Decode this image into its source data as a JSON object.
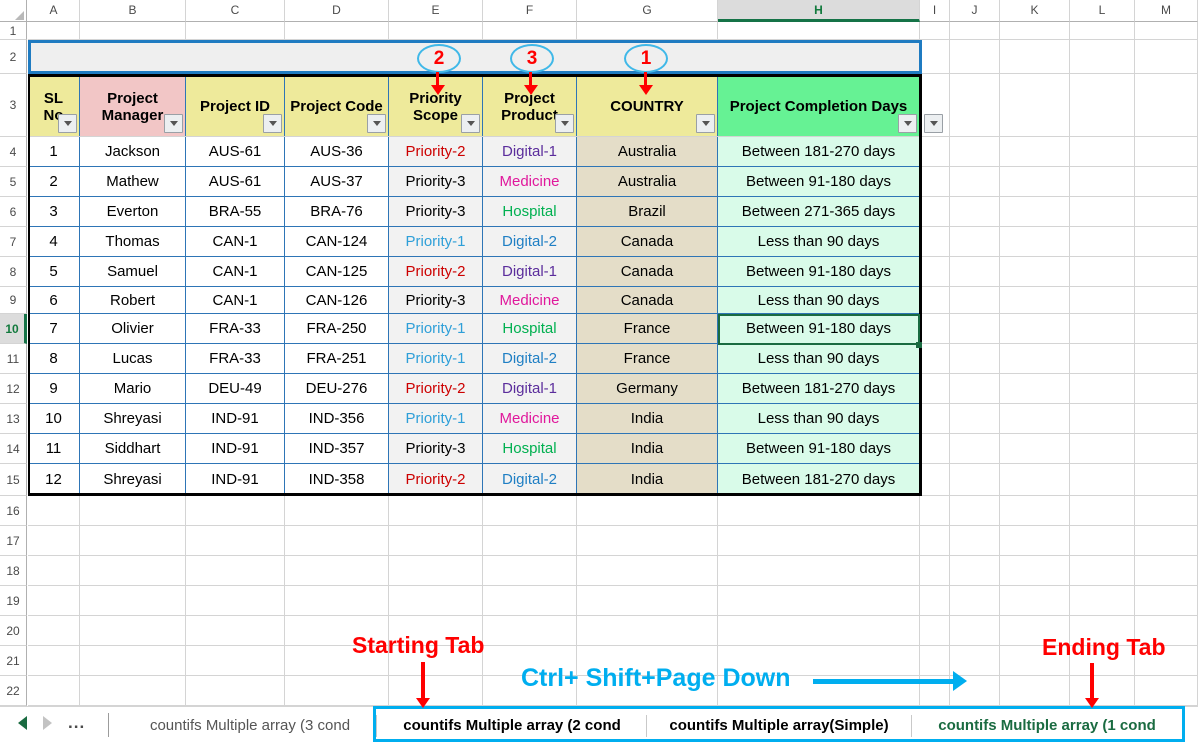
{
  "app": {
    "type": "spreadsheet"
  },
  "grid": {
    "column_letters": [
      "A",
      "B",
      "C",
      "D",
      "E",
      "F",
      "G",
      "H",
      "I",
      "J",
      "K",
      "L",
      "M"
    ],
    "selected_column": "H",
    "row_numbers": [
      "1",
      "2",
      "3",
      "4",
      "5",
      "6",
      "7",
      "8",
      "9",
      "10",
      "11",
      "12",
      "13",
      "14",
      "15",
      "16",
      "17",
      "18",
      "19",
      "20",
      "21",
      "22"
    ],
    "selected_row": "10",
    "active_cell": "H10"
  },
  "table": {
    "headers": [
      {
        "label": "SL No",
        "bg": "#eeea9b"
      },
      {
        "label": "Project Manager",
        "bg": "#f2c6c6"
      },
      {
        "label": "Project ID",
        "bg": "#eeea9b"
      },
      {
        "label": "Project Code",
        "bg": "#eeea9b"
      },
      {
        "label": "Priority Scope",
        "bg": "#eeea9b"
      },
      {
        "label": "Project Product",
        "bg": "#eeea9b"
      },
      {
        "label": "COUNTRY",
        "bg": "#eeea9b"
      },
      {
        "label": "Project Completion Days",
        "bg": "#66f294"
      }
    ],
    "rows": [
      {
        "sl": "1",
        "manager": "Jackson",
        "project_id": "AUS-61",
        "project_code": "AUS-36",
        "priority": "Priority-2",
        "priority_color": "#cc0000",
        "product": "Digital-1",
        "product_color": "#5b2d9c",
        "country": "Australia",
        "days": "Between 181-270 days"
      },
      {
        "sl": "2",
        "manager": "Mathew",
        "project_id": "AUS-61",
        "project_code": "AUS-37",
        "priority": "Priority-3",
        "priority_color": "#000000",
        "product": "Medicine",
        "product_color": "#e0189c",
        "country": "Australia",
        "days": "Between 91-180 days"
      },
      {
        "sl": "3",
        "manager": "Everton",
        "project_id": "BRA-55",
        "project_code": "BRA-76",
        "priority": "Priority-3",
        "priority_color": "#000000",
        "product": "Hospital",
        "product_color": "#00b050",
        "country": "Brazil",
        "days": "Between 271-365 days"
      },
      {
        "sl": "4",
        "manager": "Thomas",
        "project_id": "CAN-1",
        "project_code": "CAN-124",
        "priority": "Priority-1",
        "priority_color": "#2e9fd8",
        "product": "Digital-2",
        "product_color": "#1f7fc4",
        "country": "Canada",
        "days": "Less than 90 days"
      },
      {
        "sl": "5",
        "manager": "Samuel",
        "project_id": "CAN-1",
        "project_code": "CAN-125",
        "priority": "Priority-2",
        "priority_color": "#cc0000",
        "product": "Digital-1",
        "product_color": "#5b2d9c",
        "country": "Canada",
        "days": "Between 91-180 days"
      },
      {
        "sl": "6",
        "manager": "Robert",
        "project_id": "CAN-1",
        "project_code": "CAN-126",
        "priority": "Priority-3",
        "priority_color": "#000000",
        "product": "Medicine",
        "product_color": "#e0189c",
        "country": "Canada",
        "days": "Less than 90 days"
      },
      {
        "sl": "7",
        "manager": "Olivier",
        "project_id": "FRA-33",
        "project_code": "FRA-250",
        "priority": "Priority-1",
        "priority_color": "#2e9fd8",
        "product": "Hospital",
        "product_color": "#00b050",
        "country": "France",
        "days": "Between 91-180 days"
      },
      {
        "sl": "8",
        "manager": "Lucas",
        "project_id": "FRA-33",
        "project_code": "FRA-251",
        "priority": "Priority-1",
        "priority_color": "#2e9fd8",
        "product": "Digital-2",
        "product_color": "#1f7fc4",
        "country": "France",
        "days": "Less than 90 days"
      },
      {
        "sl": "9",
        "manager": "Mario",
        "project_id": "DEU-49",
        "project_code": "DEU-276",
        "priority": "Priority-2",
        "priority_color": "#cc0000",
        "product": "Digital-1",
        "product_color": "#5b2d9c",
        "country": "Germany",
        "days": "Between 181-270 days"
      },
      {
        "sl": "10",
        "manager": "Shreyasi",
        "project_id": "IND-91",
        "project_code": "IND-356",
        "priority": "Priority-1",
        "priority_color": "#2e9fd8",
        "product": "Medicine",
        "product_color": "#e0189c",
        "country": "India",
        "days": "Less than 90 days"
      },
      {
        "sl": "11",
        "manager": "Siddhart",
        "project_id": "IND-91",
        "project_code": "IND-357",
        "priority": "Priority-3",
        "priority_color": "#000000",
        "product": "Hospital",
        "product_color": "#00b050",
        "country": "India",
        "days": "Between 91-180 days"
      },
      {
        "sl": "12",
        "manager": "Shreyasi",
        "project_id": "IND-91",
        "project_code": "IND-358",
        "priority": "Priority-2",
        "priority_color": "#cc0000",
        "product": "Digital-2",
        "product_color": "#1f7fc4",
        "country": "India",
        "days": "Between 181-270 days"
      }
    ]
  },
  "callouts": [
    {
      "number": "2",
      "target": "Priority Scope"
    },
    {
      "number": "3",
      "target": "Project Product"
    },
    {
      "number": "1",
      "target": "COUNTRY"
    }
  ],
  "annotations": {
    "starting_tab_label": "Starting Tab",
    "ending_tab_label": "Ending Tab",
    "shortcut_label": "Ctrl+ Shift+Page Down"
  },
  "tabbar": {
    "nav": {
      "prev": "prev-sheet",
      "next": "next-sheet",
      "more": "..."
    },
    "tabs": [
      {
        "name": "countifs Multiple array (3 cond",
        "state": "inactive"
      },
      {
        "name": "countifs Multiple array (2 cond",
        "state": "highlighted-start"
      },
      {
        "name": "countifs Multiple array(Simple)",
        "state": "highlighted"
      },
      {
        "name": "countifs Multiple array (1 cond",
        "state": "highlighted-end"
      }
    ]
  },
  "colors": {
    "selection_blue": "#2e75b6",
    "callout_blue": "#3fb8e8",
    "annotation_red": "#ff0000",
    "shortcut_blue": "#00aeef",
    "active_green": "#157347"
  }
}
